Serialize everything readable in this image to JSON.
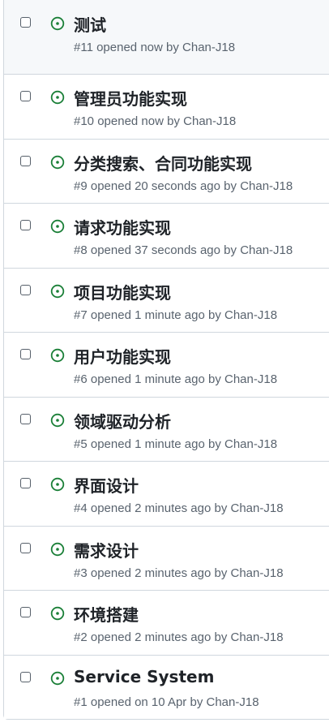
{
  "issues": [
    {
      "title": "测试",
      "number": "#11",
      "opened": "opened now",
      "by": "by",
      "author": "Chan-J18"
    },
    {
      "title": "管理员功能实现",
      "number": "#10",
      "opened": "opened now",
      "by": "by",
      "author": "Chan-J18"
    },
    {
      "title": "分类搜索、合同功能实现",
      "number": "#9",
      "opened": "opened 20 seconds ago",
      "by": "by",
      "author": "Chan-J18"
    },
    {
      "title": "请求功能实现",
      "number": "#8",
      "opened": "opened 37 seconds ago",
      "by": "by",
      "author": "Chan-J18"
    },
    {
      "title": "项目功能实现",
      "number": "#7",
      "opened": "opened 1 minute ago",
      "by": "by",
      "author": "Chan-J18"
    },
    {
      "title": "用户功能实现",
      "number": "#6",
      "opened": "opened 1 minute ago",
      "by": "by",
      "author": "Chan-J18"
    },
    {
      "title": "领域驱动分析",
      "number": "#5",
      "opened": "opened 1 minute ago",
      "by": "by",
      "author": "Chan-J18"
    },
    {
      "title": "界面设计",
      "number": "#4",
      "opened": "opened 2 minutes ago",
      "by": "by",
      "author": "Chan-J18"
    },
    {
      "title": "需求设计",
      "number": "#3",
      "opened": "opened 2 minutes ago",
      "by": "by",
      "author": "Chan-J18"
    },
    {
      "title": "环境搭建",
      "number": "#2",
      "opened": "opened 2 minutes ago",
      "by": "by",
      "author": "Chan-J18"
    },
    {
      "title": "Service System",
      "number": "#1",
      "opened": "opened on 10 Apr",
      "by": "by",
      "author": "Chan-J18"
    }
  ],
  "colors": {
    "open_icon": "#1a7f37",
    "title": "#1f2328",
    "meta": "#59636e",
    "border": "#d0d7de",
    "highlight_row": "#f6f8fa"
  },
  "icons": {
    "status": "issue-opened-icon",
    "checkbox": "checkbox"
  }
}
